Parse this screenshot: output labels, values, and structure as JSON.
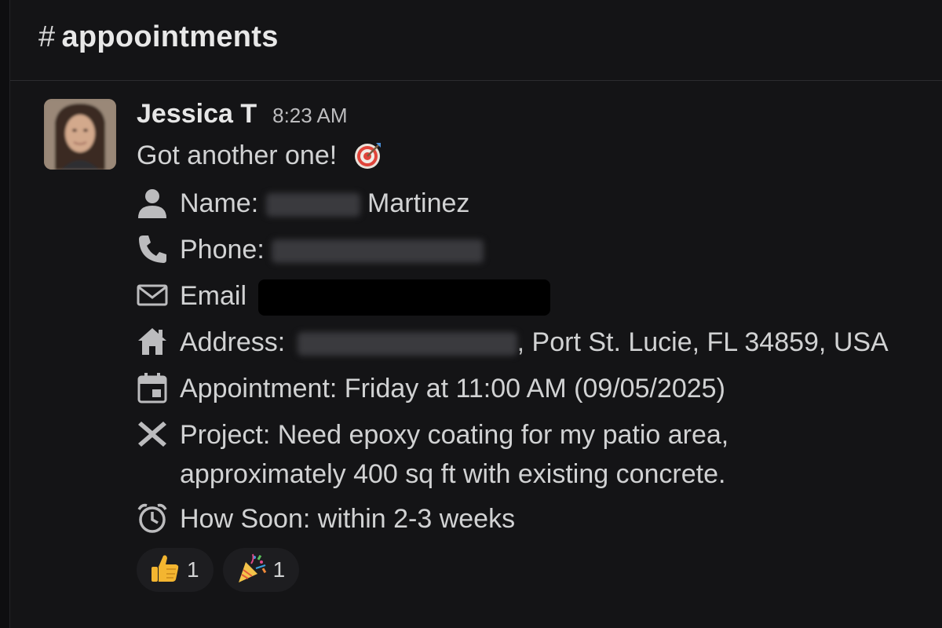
{
  "channel": {
    "hash": "#",
    "name": "appoointments"
  },
  "message": {
    "author": "Jessica T",
    "time": "8:23 AM",
    "intro": "Got another one!",
    "fields": {
      "name_label": "Name:",
      "name_value": "Martinez",
      "phone_label": "Phone:",
      "email_label": "Email",
      "address_label": "Address:",
      "address_value": ", Port St. Lucie, FL 34859, USA",
      "appointment": "Appointment: Friday at 11:00 AM (09/05/2025)",
      "project_line1": "Project: Need epoxy coating for my patio area,",
      "project_line2": "approximately 400 sq ft with existing concrete.",
      "how_soon": "How Soon: within 2-3 weeks"
    },
    "icons": [
      "person-icon",
      "phone-icon",
      "envelope-icon",
      "house-icon",
      "calendar-icon",
      "x-icon",
      "alarm-clock-icon",
      "target-icon"
    ]
  },
  "reactions": [
    {
      "emoji": "thumbs-up",
      "count": "1"
    },
    {
      "emoji": "party-popper",
      "count": "1"
    }
  ],
  "colors": {
    "background": "#141416",
    "text": "#d1d2d3",
    "icon": "#c8c8ca",
    "accent_target": "#e0443a"
  }
}
